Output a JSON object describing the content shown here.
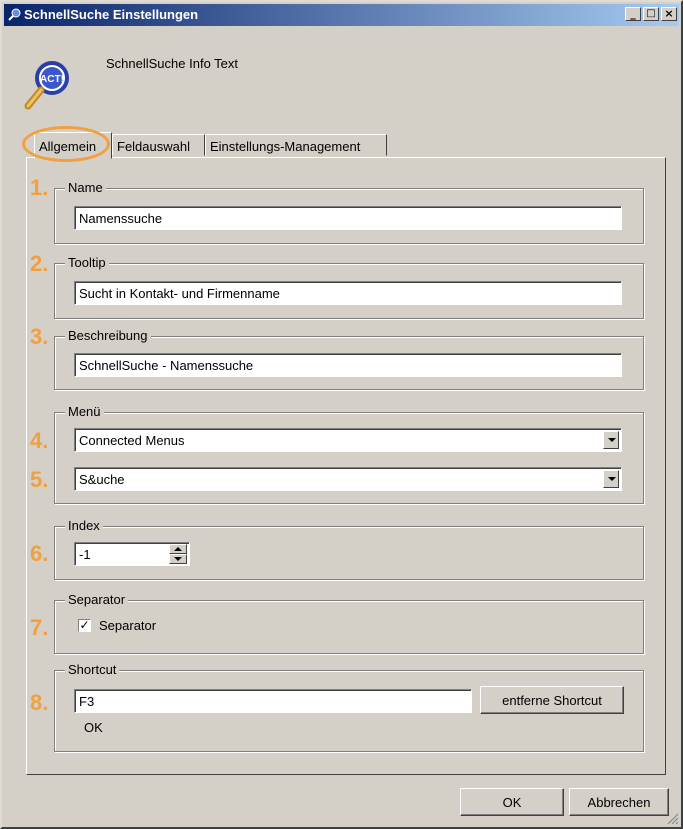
{
  "window": {
    "title": "SchnellSuche Einstellungen",
    "minimize": "_",
    "maximize": "□",
    "close": "×"
  },
  "info": {
    "text": "SchnellSuche Info Text",
    "icon": "magnifier-act-icon",
    "icon_label": "ACT!"
  },
  "tabs": [
    {
      "label": "Allgemein",
      "active": true
    },
    {
      "label": "Feldauswahl",
      "active": false
    },
    {
      "label": "Einstellungs-Management",
      "active": false
    }
  ],
  "markers": [
    "1.",
    "2.",
    "3.",
    "4.",
    "5.",
    "6.",
    "7.",
    "8."
  ],
  "name": {
    "legend": "Name",
    "value": "Namenssuche"
  },
  "tooltip": {
    "legend": "Tooltip",
    "value": "Sucht in Kontakt- und Firmenname"
  },
  "description": {
    "legend": "Beschreibung",
    "value": "SchnellSuche - Namenssuche"
  },
  "menu": {
    "legend": "Menü",
    "menu_value": "Connected Menus",
    "submenu_value": "S&uche"
  },
  "index": {
    "legend": "Index",
    "value": "-1"
  },
  "separator": {
    "legend": "Separator",
    "label": "Separator",
    "checked": true,
    "check_glyph": "✓"
  },
  "shortcut": {
    "legend": "Shortcut",
    "value": "F3",
    "remove_label": "entferne Shortcut",
    "status": "OK"
  },
  "footer": {
    "ok_label": "OK",
    "cancel_label": "Abbrechen"
  },
  "colors": {
    "titlebar_start": "#0a246a",
    "titlebar_end": "#a6caf0",
    "face": "#d4d0c8",
    "marker": "#f0a040"
  }
}
